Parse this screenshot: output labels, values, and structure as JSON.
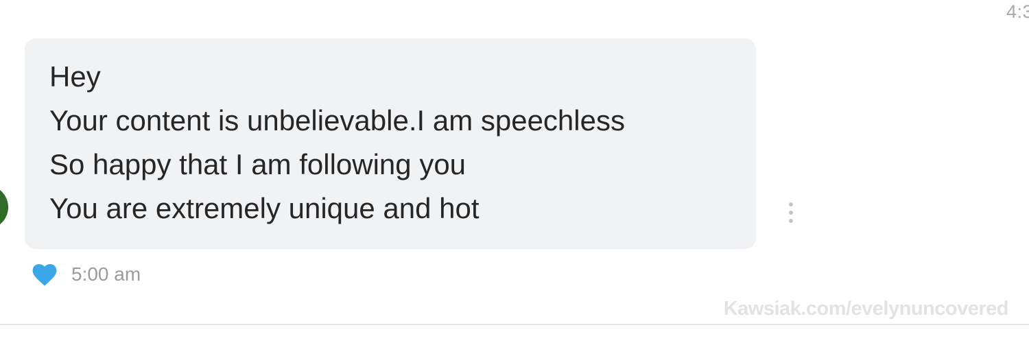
{
  "header": {
    "time": "4:3"
  },
  "message": {
    "lines": [
      "Hey",
      "Your content is unbelievable.I am speechless",
      "So happy that I am following you",
      "You are extremely unique and hot"
    ],
    "time": "5:00 am",
    "reaction_icon": "heart-icon",
    "reaction_color": "#3aa7e8",
    "bubble_color": "#f1f2f4",
    "more_icon": "more-vertical-icon"
  },
  "avatar": {
    "color": "#2e6b26"
  },
  "watermark": {
    "text": "Kawsiak.com/evelynuncovered"
  }
}
